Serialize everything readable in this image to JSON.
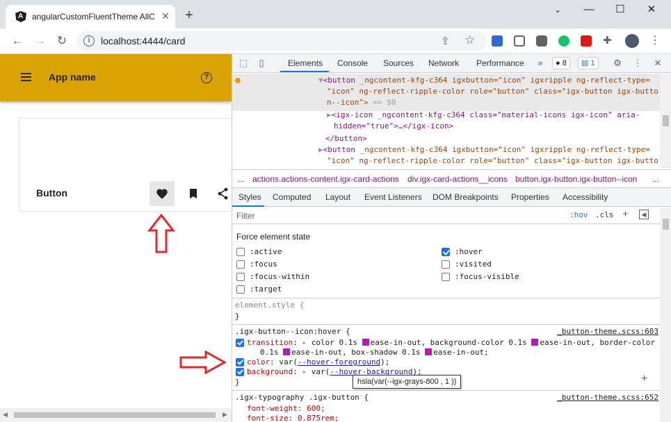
{
  "browser": {
    "tab_title": "angularCustomFluentTheme AllC",
    "tab_icon": "angular-icon",
    "url": "localhost:4444/card",
    "new_tab": "+",
    "window_controls": [
      "⌄",
      "—",
      "☐",
      "✕"
    ]
  },
  "app": {
    "name": "App name",
    "card_button_label": "Button"
  },
  "devtools": {
    "tabs": [
      "Elements",
      "Console",
      "Sources",
      "Network",
      "Performance"
    ],
    "issues_count": "8",
    "messages_count": "1",
    "dom": {
      "l1_tag": "<button",
      "l1_attrs": " _ngcontent-kfg-c364 igxbutton=\"icon\" igxripple ng-reflect-type=",
      "l2": "\"icon\" ng-reflect-ripple-color role=\"button\" class=\"igx-button igx-butto",
      "l3": "n--icon\">",
      "l3_eq": " == $0",
      "l4": "<igx-icon _ngcontent-kfg-c364 class=\"material-icons igx-icon\" aria-",
      "l5": "hidden=\"true\">…</igx-icon>",
      "l6": "</button>",
      "l7_tag": "<button",
      "l7_attrs": " _ngcontent-kfg-c364 igxbutton=\"icon\" igxripple ng-reflect-type=",
      "l8": "\"icon\" ng-reflect-ripple-color role=\"button\" class=\"igx-button igx-butto"
    },
    "breadcrumbs": [
      "...",
      "actions.actions-content.igx-card-actions",
      "div.igx-card-actions__icons",
      "button.igx-button.igx-button--icon",
      "..."
    ],
    "sub_tabs": [
      "Styles",
      "Computed",
      "Layout",
      "Event Listeners",
      "DOM Breakpoints",
      "Properties",
      "Accessibility"
    ],
    "filter_placeholder": "Filter",
    "hov": ":hov",
    "cls": ".cls",
    "force_state": {
      "title": "Force element state",
      "states": [
        {
          "label": ":active",
          "checked": false
        },
        {
          "label": ":focus",
          "checked": false
        },
        {
          "label": ":focus-within",
          "checked": false
        },
        {
          "label": ":target",
          "checked": false
        },
        {
          "label": ":hover",
          "checked": true
        },
        {
          "label": ":visited",
          "checked": false
        },
        {
          "label": ":focus-visible",
          "checked": false
        }
      ]
    },
    "rules": {
      "element_style": "element.style {",
      "close": "}",
      "hover_selector": ".igx-button--icon:hover {",
      "hover_source": "_button-theme.scss:603",
      "transition_prop": "transition",
      "transition_v1": " color 0.1s ",
      "transition_v2": "ease-in-out, background-color 0.1s ",
      "transition_v3": "ease-in-out, border-color",
      "transition_v4": "0.1s ",
      "transition_v5": "ease-in-out, box-shadow 0.1s ",
      "transition_v6": "ease-in-out;",
      "color_prop": "color",
      "color_var": "--hover-foreground",
      "background_prop": "background",
      "background_var": "--hover-background",
      "tooltip": "hsla(var(--igx-grays-800 , 1 ))",
      "typo_selector": ".igx-typography .igx-button {",
      "typo_source": "_button-theme.scss:652",
      "font_weight": "font-weight: 600;",
      "font_size": "font-size: 0.875rem;"
    }
  },
  "annotation_color": "#e3262b",
  "accent": "#d9a303"
}
